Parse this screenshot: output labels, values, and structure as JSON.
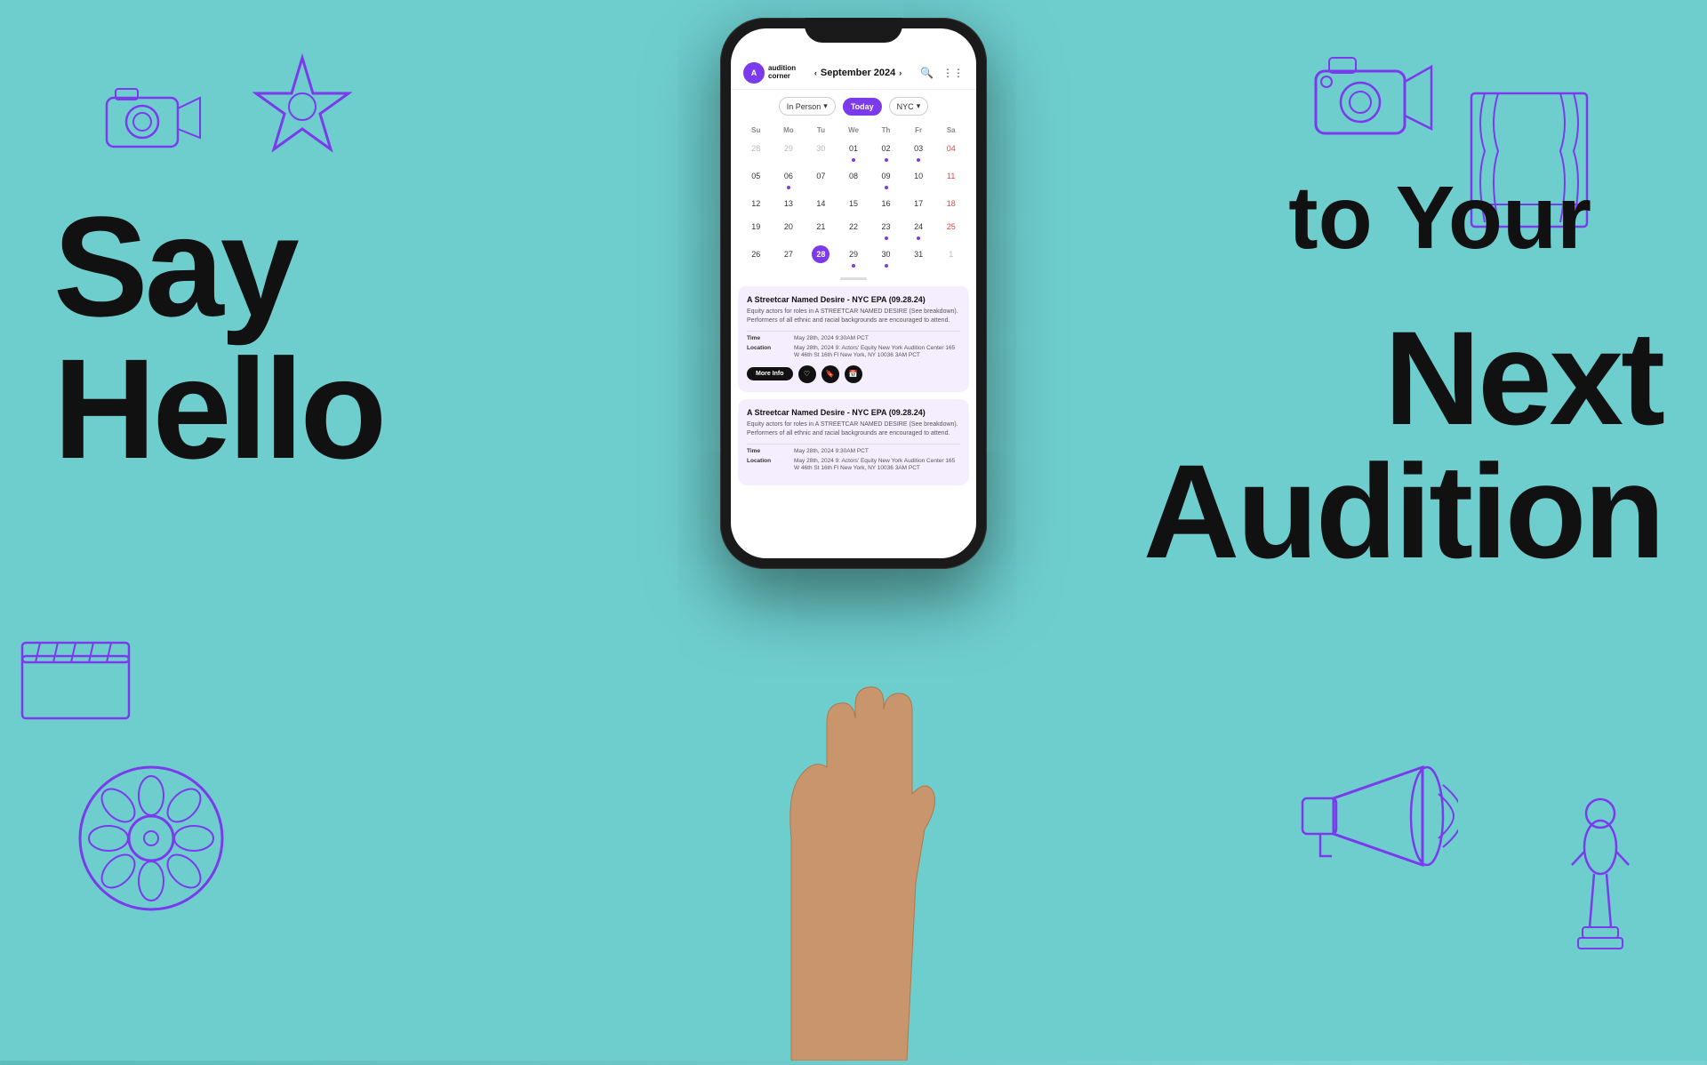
{
  "app": {
    "background_color": "#6ecece",
    "logo_line1": "audition",
    "logo_line2": "corner"
  },
  "hero": {
    "say": "Say",
    "hello": "Hello",
    "to_your": "to Your",
    "next": "Next",
    "audition": "Audition"
  },
  "phone": {
    "header": {
      "month": "September 2024",
      "search_icon": "search",
      "grid_icon": "grid"
    },
    "filters": {
      "in_person": "In Person",
      "today": "Today",
      "nyc": "NYC"
    },
    "calendar": {
      "days": [
        "Su",
        "Mo",
        "Tu",
        "We",
        "Th",
        "Fr",
        "Sa"
      ],
      "weeks": [
        [
          {
            "num": "28",
            "other": true
          },
          {
            "num": "29",
            "other": true
          },
          {
            "num": "30",
            "other": true
          },
          {
            "num": "01",
            "event": true
          },
          {
            "num": "02",
            "event": true
          },
          {
            "num": "03",
            "event": true
          },
          {
            "num": "04",
            "weekend": true,
            "event": true
          }
        ],
        [
          {
            "num": "05"
          },
          {
            "num": "06",
            "event": true
          },
          {
            "num": "07"
          },
          {
            "num": "08"
          },
          {
            "num": "09",
            "event": true
          },
          {
            "num": "10"
          },
          {
            "num": "11",
            "weekend": true,
            "event_red": true
          }
        ],
        [
          {
            "num": "12"
          },
          {
            "num": "13"
          },
          {
            "num": "14"
          },
          {
            "num": "15"
          },
          {
            "num": "16"
          },
          {
            "num": "17"
          },
          {
            "num": "18",
            "weekend": true,
            "event_red": true
          }
        ],
        [
          {
            "num": "19"
          },
          {
            "num": "20"
          },
          {
            "num": "21"
          },
          {
            "num": "22"
          },
          {
            "num": "23",
            "event": true
          },
          {
            "num": "24",
            "event": true
          },
          {
            "num": "25",
            "weekend": true,
            "event_red": true
          }
        ],
        [
          {
            "num": "26"
          },
          {
            "num": "27"
          },
          {
            "num": "28",
            "today": true
          },
          {
            "num": "29",
            "event": true
          },
          {
            "num": "30",
            "event": true
          },
          {
            "num": "31"
          },
          {
            "num": "1",
            "other": true
          }
        ]
      ]
    },
    "cards": [
      {
        "title": "A Streetcar Named Desire - NYC EPA (09.28.24)",
        "description": "Equity actors for roles in A STREETCAR NAMED DESIRE (See breakdown). Performers of all ethnic and racial backgrounds are encouraged to attend.",
        "time_label": "Time",
        "time_value": "May 28th, 2024 9:30AM PCT",
        "location_label": "Location",
        "location_value": "May 28th, 2024 9: Actors' Equity New York Audition Center 165 W 46th St 16th Fl New York, NY 10036 3AM PCT",
        "more_info": "More Info",
        "actions": [
          "heart",
          "bookmark",
          "calendar"
        ]
      },
      {
        "title": "A Streetcar Named Desire - NYC EPA (09.28.24)",
        "description": "Equity actors for roles in A STREETCAR NAMED DESIRE (See breakdown). Performers of all ethnic and racial backgrounds are encouraged to attend.",
        "time_label": "Time",
        "time_value": "May 28th, 2024 9:30AM PCT",
        "location_label": "Location",
        "location_value": "May 28th, 2024 9: Actors' Equity New York Audition Center 165 W 46th St 16th Fl New York, NY 10036 3AM PCT"
      }
    ]
  }
}
